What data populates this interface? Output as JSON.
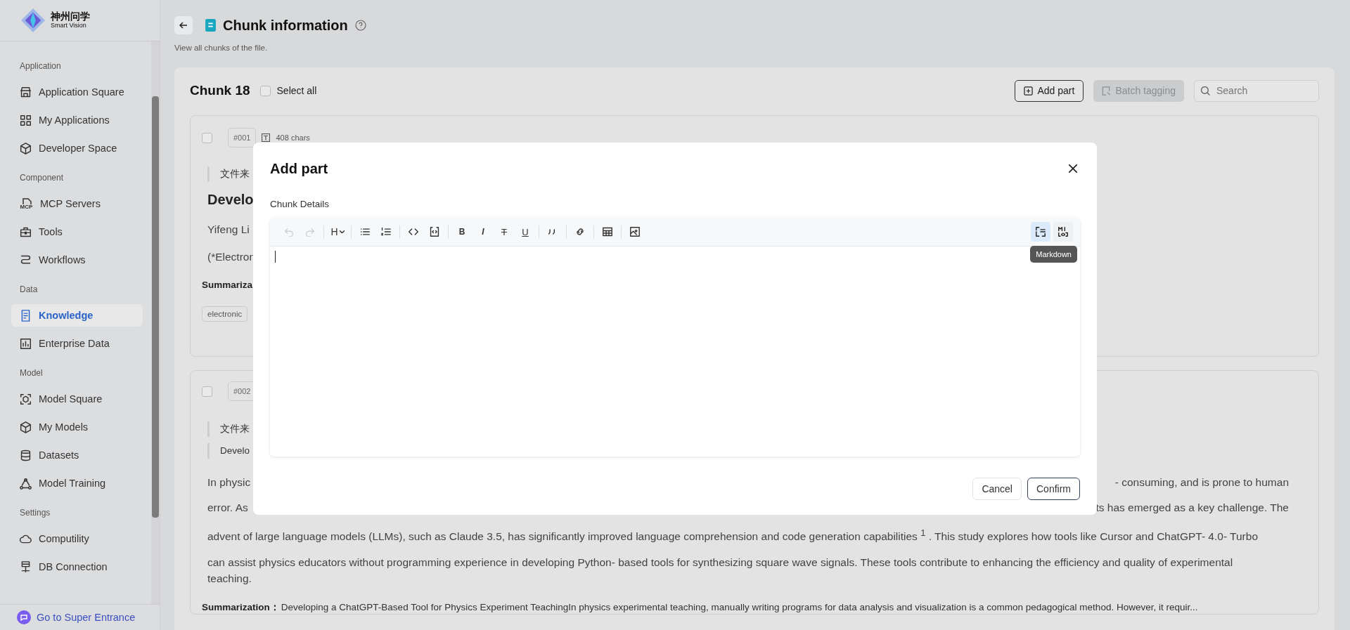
{
  "sidebar": {
    "logo": {
      "title": "神州问学",
      "subtitle": "Smart Vision"
    },
    "sections": [
      {
        "label": "Application",
        "items": [
          {
            "label": "Application Square",
            "selected": false
          },
          {
            "label": "My Applications",
            "selected": false
          },
          {
            "label": "Developer Space",
            "selected": false
          }
        ]
      },
      {
        "label": "Component",
        "items": [
          {
            "label": "MCP Servers",
            "icon_text": "MCP",
            "selected": false
          },
          {
            "label": "Tools",
            "selected": false
          },
          {
            "label": "Workflows",
            "selected": false
          }
        ]
      },
      {
        "label": "Data",
        "items": [
          {
            "label": "Knowledge",
            "selected": true
          },
          {
            "label": "Enterprise Data",
            "selected": false
          }
        ]
      },
      {
        "label": "Model",
        "items": [
          {
            "label": "Model Square",
            "selected": false
          },
          {
            "label": "My Models",
            "selected": false
          },
          {
            "label": "Datasets",
            "selected": false
          },
          {
            "label": "Model Training",
            "selected": false
          }
        ]
      },
      {
        "label": "Settings",
        "items": [
          {
            "label": "Computility",
            "selected": false
          },
          {
            "label": "DB Connection",
            "selected": false
          }
        ]
      }
    ],
    "footer": "Go to Super Entrance"
  },
  "header": {
    "title": "Chunk information",
    "subtitle": "View all chunks of the file."
  },
  "panel": {
    "title": "Chunk 18",
    "select_all": {
      "label": "Select all",
      "checked": false
    },
    "add_button": "Add part",
    "batch_button": {
      "label": "Batch tagging",
      "disabled": true
    },
    "search": {
      "placeholder": "Search"
    }
  },
  "chunks": [
    {
      "checked": false,
      "number": "#001",
      "chars": "408 chars",
      "source": "文件来",
      "heading": "Develo",
      "lines": [
        "Yifeng Li",
        "(*Electron"
      ],
      "summary_label": "Summariza",
      "tags": [
        "electronic"
      ]
    },
    {
      "checked": false,
      "number": "#002",
      "source": "文件来",
      "quote": "Develo",
      "split_lines": [
        [
          "In physic",
          "- consuming, and is prone to human"
        ],
        [
          "error. As",
          "ts has emerged as a key challenge. The"
        ]
      ],
      "lines": [
        "advent of large language models (LLMs), such as Claude 3.5, has significantly improved language comprehension and code generation capabilities $^{1}$ . This study explores how tools like Cursor and ChatGPT- 4.0- Turbo",
        "can assist physics educators without programming experience in developing Python- based tools for synthesizing square wave signals. These tools contribute to enhancing the efficiency and quality of experimental teaching."
      ],
      "summary_label": "Summarization：",
      "summary": "Developing a ChatGPT-Based Tool for Physics Experiment TeachingIn physics experimental teaching, manually writing programs for data analysis and visualization is a common pedagogical method. However, it requir..."
    }
  ],
  "dialog": {
    "title": "Add part",
    "field_label": "Chunk Details",
    "toolbar": [
      {
        "kind": "undo",
        "disabled": true
      },
      {
        "kind": "redo",
        "disabled": true
      },
      {
        "kind": "sep"
      },
      {
        "kind": "heading",
        "label": "H",
        "disabled": false
      },
      {
        "kind": "sep"
      },
      {
        "kind": "bullet",
        "disabled": false
      },
      {
        "kind": "ordered",
        "disabled": false
      },
      {
        "kind": "sep"
      },
      {
        "kind": "code",
        "disabled": false
      },
      {
        "kind": "codeblock",
        "disabled": false
      },
      {
        "kind": "sep"
      },
      {
        "kind": "bold",
        "label": "B",
        "disabled": false
      },
      {
        "kind": "italic",
        "label": "I",
        "disabled": false
      },
      {
        "kind": "strike",
        "label": "T",
        "disabled": false
      },
      {
        "kind": "underline",
        "label": "U",
        "disabled": false
      },
      {
        "kind": "sep"
      },
      {
        "kind": "quote",
        "disabled": false
      },
      {
        "kind": "sep"
      },
      {
        "kind": "link",
        "disabled": false
      },
      {
        "kind": "sep"
      },
      {
        "kind": "table",
        "disabled": false
      },
      {
        "kind": "sep"
      },
      {
        "kind": "image",
        "disabled": false
      }
    ],
    "modes": [
      {
        "kind": "source",
        "selected": true
      },
      {
        "kind": "markdown",
        "selected": false
      }
    ],
    "tooltip": "Markdown",
    "cancel": "Cancel",
    "confirm": "Confirm"
  }
}
